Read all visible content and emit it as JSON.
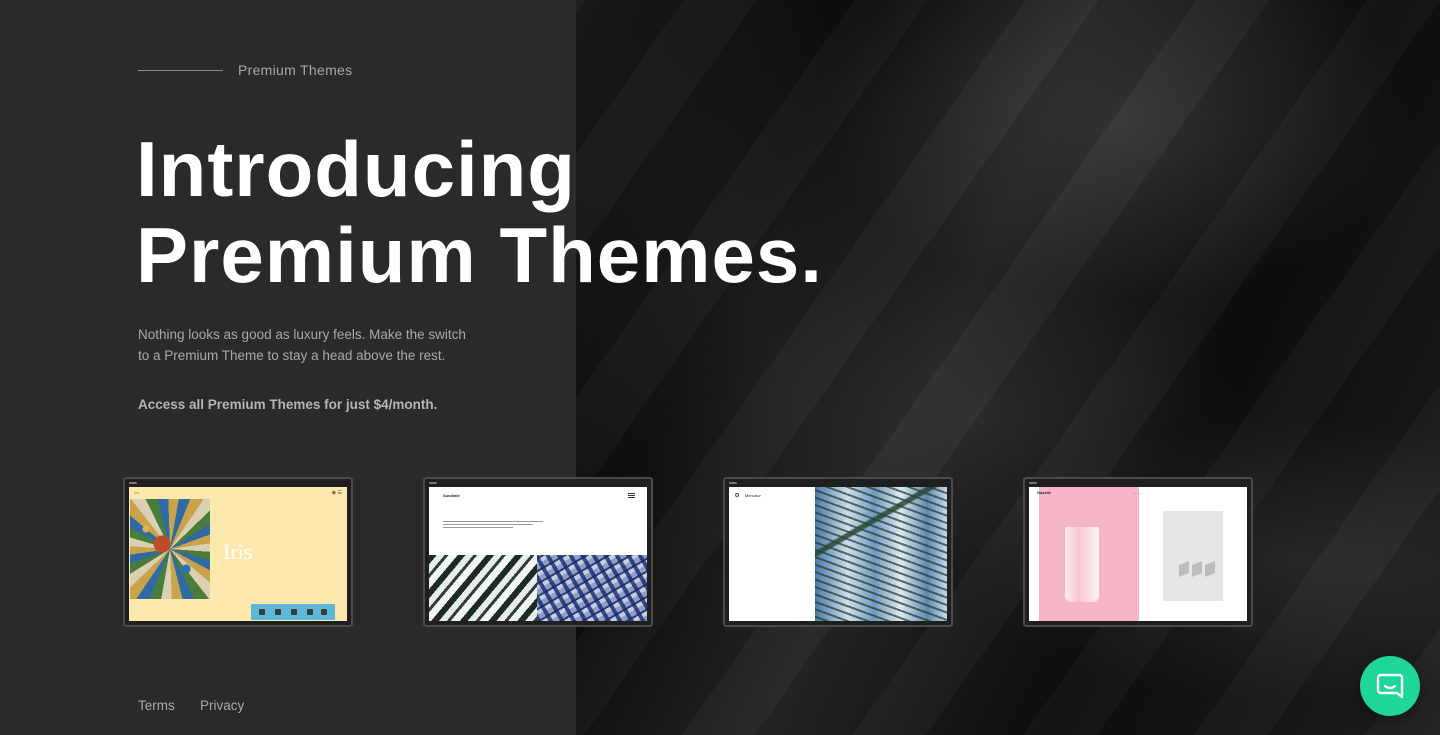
{
  "eyebrow": {
    "label": "Premium Themes"
  },
  "headline": {
    "line1": "Introducing",
    "line2": "Premium Themes."
  },
  "lead": {
    "line1": "Nothing looks as good as luxury feels. Make the switch",
    "line2": "to a Premium Theme to stay a head above the rest."
  },
  "offer": {
    "text": "Access all Premium Themes for just $4/month."
  },
  "themes": [
    {
      "key": "iris",
      "title": "Iris"
    },
    {
      "key": "sundiale",
      "title": "Sundiale"
    },
    {
      "key": "mercator",
      "title": "Mercator"
    },
    {
      "key": "gazelle",
      "title": "Gazelle"
    }
  ],
  "footer": {
    "terms": "Terms",
    "privacy": "Privacy"
  },
  "chat": {
    "icon": "chat-icon",
    "accent": "#1ed69a"
  },
  "colors": {
    "left_panel": "#2a2a2a",
    "text_muted": "#a9a9a9"
  }
}
